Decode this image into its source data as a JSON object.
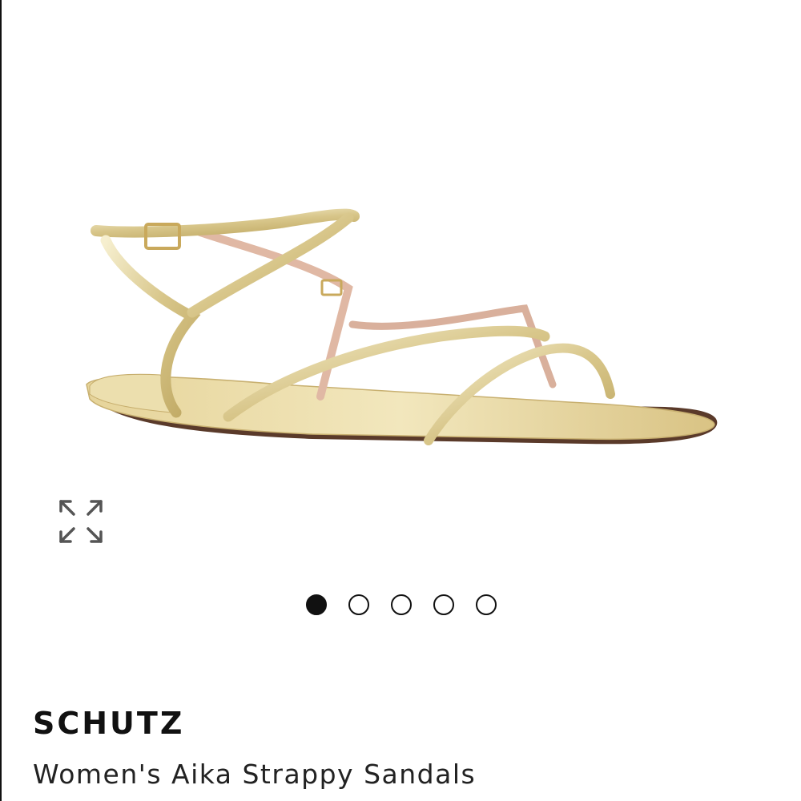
{
  "product": {
    "brand": "SCHUTZ",
    "name": "Women's Aika Strappy Sandals",
    "image_alt": "Gold metallic strappy flat sandal"
  },
  "gallery": {
    "total_images": 5,
    "active_index": 0,
    "expand_icon": "expand-arrows-icon"
  },
  "colors": {
    "gold": "#d9c98a",
    "gold_highlight": "#f3ebc8",
    "sole": "#5a3a2a",
    "dot": "#111111"
  }
}
